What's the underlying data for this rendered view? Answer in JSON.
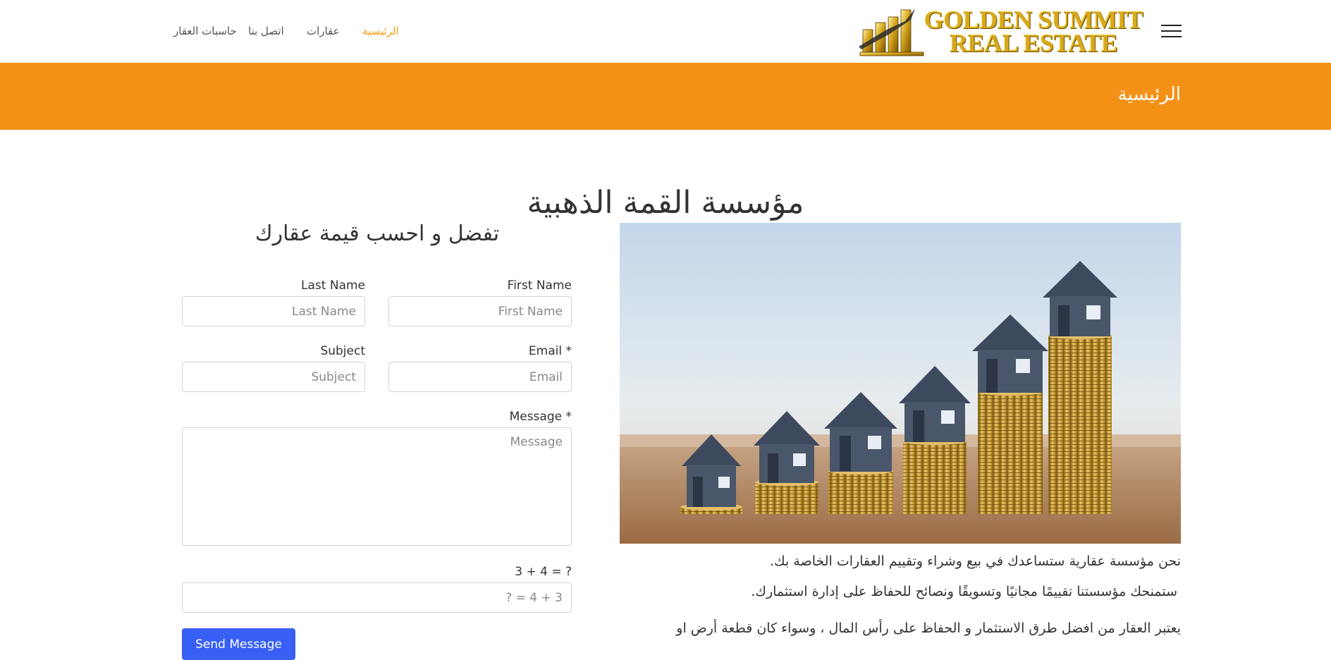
{
  "header": {
    "logo": {
      "line1": "GOLDEN SUMMIT",
      "line2": "REAL ESTATE"
    },
    "nav": {
      "home": "الرئيسية",
      "properties": "عقارات",
      "contact": "اتصل بنا",
      "calculators": "حاسبات العقار"
    },
    "menu_icon": "hamburger-menu-icon"
  },
  "banner": {
    "title": "الرئيسية"
  },
  "main": {
    "title": "مؤسسة القمة الذهبية",
    "form_title": "تفضل و احسب قيمة عقارك",
    "description": [
      "نحن مؤسسة عقارية ستساعدك في بيع وشراء وتقييم العقارات الخاصة بك.",
      "ستمنحك مؤسستنا تقييمًا مجانيًا وتسويقًا ونصائح للحفاظ على إدارة استثمارك.",
      "يعتبر العقار من افضل طرق الاستثمار و الحفاظ على رأس المال ، وسواء كان قطعة أرض او"
    ]
  },
  "form": {
    "first_name": {
      "label": "First Name",
      "placeholder": "First Name"
    },
    "last_name": {
      "label": "Last Name",
      "placeholder": "Last Name"
    },
    "email": {
      "label": "Email *",
      "placeholder": "Email"
    },
    "subject": {
      "label": "Subject",
      "placeholder": "Subject"
    },
    "message": {
      "label": "Message *",
      "placeholder": "Message"
    },
    "captcha": {
      "label": "3 + 4 = ?",
      "placeholder": "3 + 4 = ?"
    },
    "submit": "Send Message"
  },
  "colors": {
    "accent": "#f39016",
    "nav_active": "#f39c12",
    "button": "#3860f5"
  }
}
